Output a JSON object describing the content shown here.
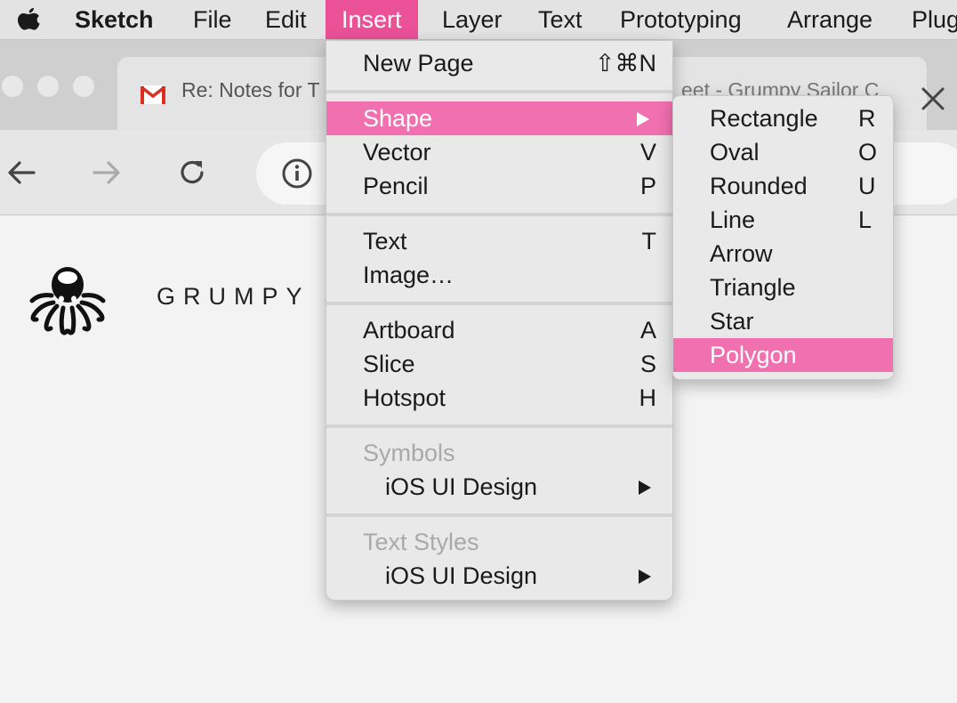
{
  "menubar": {
    "app_name": "Sketch",
    "items": [
      "File",
      "Edit",
      "Insert",
      "Layer",
      "Text",
      "Prototyping",
      "Arrange",
      "Plug"
    ],
    "active_item": "Insert",
    "accent_color": "#ea5197"
  },
  "browser": {
    "tab": {
      "title": "Re: Notes for T",
      "title_background": "eet - Grumpy Sailor C"
    }
  },
  "page": {
    "brand": "GRUMPY S"
  },
  "insert_menu": {
    "items": [
      {
        "label": "New Page",
        "shortcut": "⇧⌘N"
      },
      {
        "label": "Shape",
        "has_submenu": true,
        "highlighted": true
      },
      {
        "label": "Vector",
        "shortcut": "V"
      },
      {
        "label": "Pencil",
        "shortcut": "P"
      },
      {
        "label": "Text",
        "shortcut": "T"
      },
      {
        "label": "Image…"
      },
      {
        "label": "Artboard",
        "shortcut": "A"
      },
      {
        "label": "Slice",
        "shortcut": "S"
      },
      {
        "label": "Hotspot",
        "shortcut": "H"
      },
      {
        "label": "Symbols",
        "disabled": true
      },
      {
        "label": "iOS UI Design",
        "has_submenu": true
      },
      {
        "label": "Text Styles",
        "disabled": true
      },
      {
        "label": "iOS UI Design",
        "has_submenu": true
      }
    ]
  },
  "shape_submenu": {
    "items": [
      {
        "label": "Rectangle",
        "shortcut": "R"
      },
      {
        "label": "Oval",
        "shortcut": "O"
      },
      {
        "label": "Rounded",
        "shortcut": "U"
      },
      {
        "label": "Line",
        "shortcut": "L"
      },
      {
        "label": "Arrow"
      },
      {
        "label": "Triangle"
      },
      {
        "label": "Star"
      },
      {
        "label": "Polygon",
        "highlighted": true
      }
    ],
    "highlight_color": "#f170b0"
  }
}
